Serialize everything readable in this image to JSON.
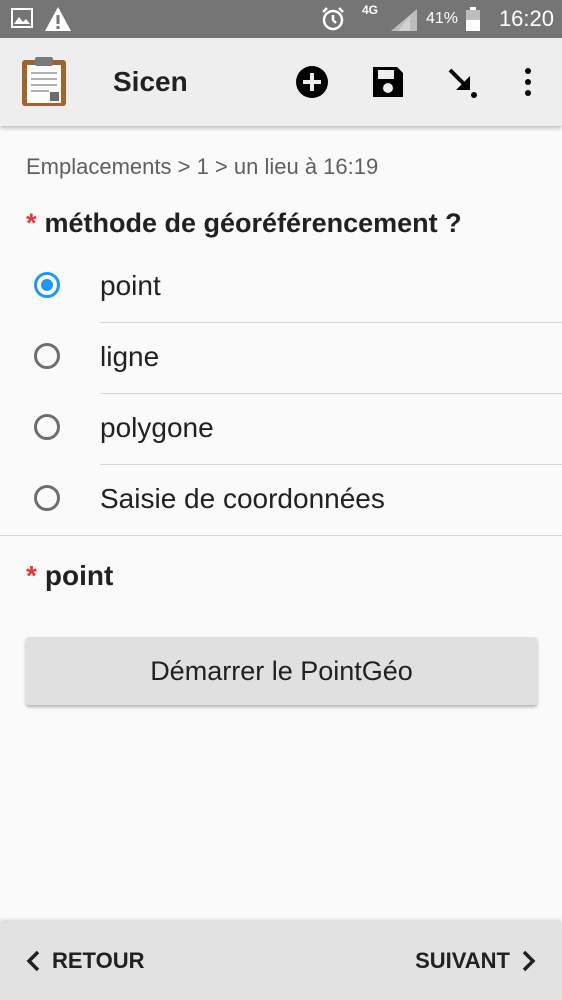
{
  "status_bar": {
    "network": "4G",
    "battery": "41%",
    "time": "16:20"
  },
  "app_bar": {
    "title": "Sicen"
  },
  "breadcrumb": "Emplacements > 1 > un lieu à 16:19",
  "question": {
    "required_marker": "*",
    "label": "méthode de géoréférencement ?",
    "options": [
      {
        "label": "point",
        "selected": true
      },
      {
        "label": "ligne",
        "selected": false
      },
      {
        "label": "polygone",
        "selected": false
      },
      {
        "label": "Saisie de coordonnées",
        "selected": false
      }
    ]
  },
  "point_field": {
    "required_marker": "*",
    "label": "point",
    "button_label": "Démarrer le PointGéo"
  },
  "navigation": {
    "back_label": "RETOUR",
    "next_label": "SUIVANT"
  },
  "colors": {
    "accent": "#2196f3",
    "required": "#e53935",
    "status_bar": "#757575"
  }
}
